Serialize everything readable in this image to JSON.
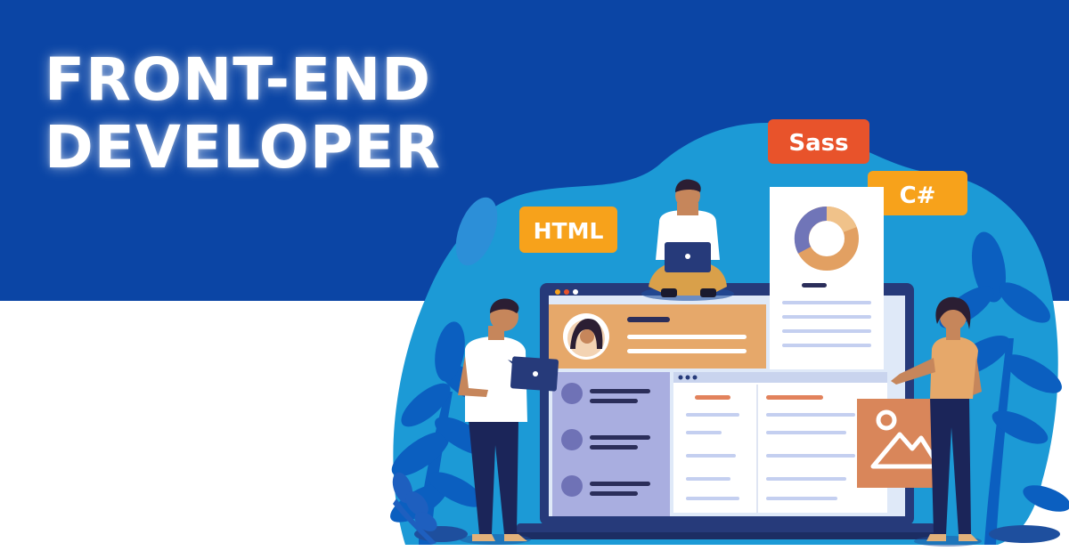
{
  "title": {
    "line1": "FRONT-END",
    "line2": "DEVELOPER"
  },
  "tags": {
    "html": "HTML",
    "sass": "Sass",
    "csharp": "C#"
  },
  "colors": {
    "banner": "#0b45a5",
    "cloud": "#1c9ad6",
    "leaf": "#0b5fc0",
    "tag_yellow": "#f7a21b",
    "tag_red": "#e8532b",
    "orange_panel": "#e6a86a",
    "lavender_panel": "#a9aee0",
    "laptop": "#263a7a"
  },
  "icons": {
    "donut_chart": "donut-chart-icon",
    "image_placeholder": "image-placeholder-icon",
    "avatar": "avatar-icon"
  }
}
